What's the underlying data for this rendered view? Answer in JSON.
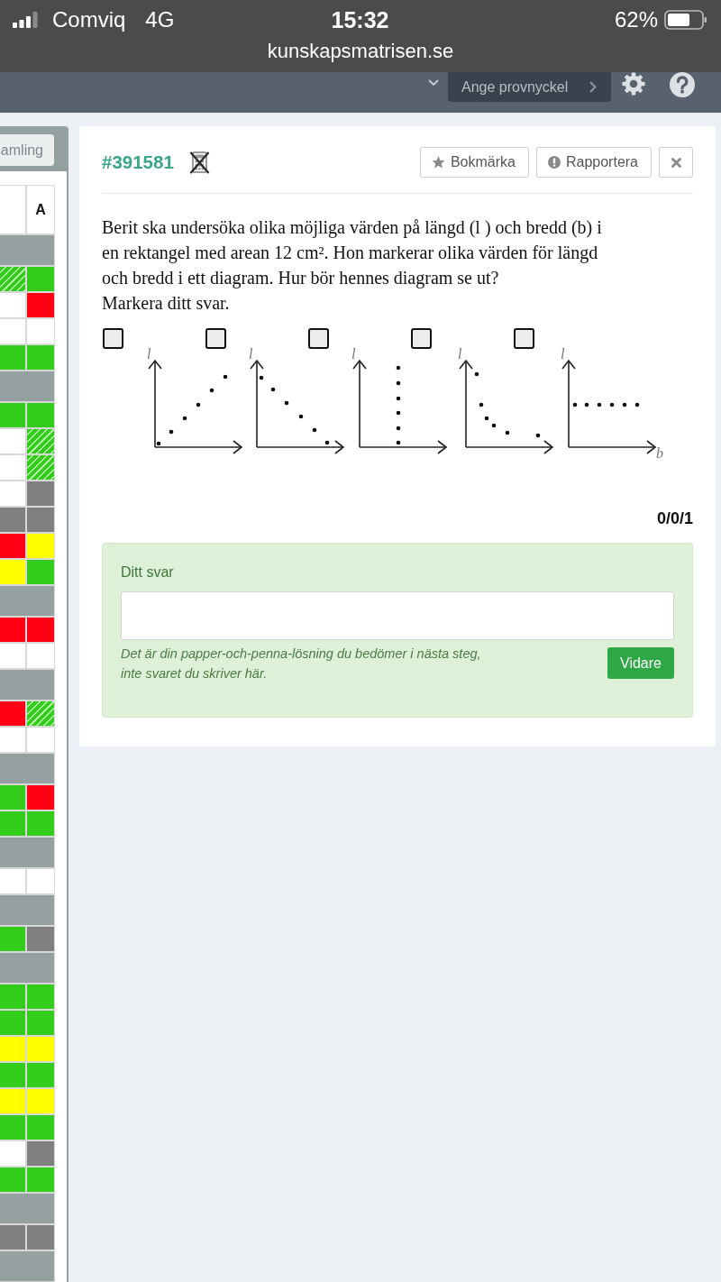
{
  "status_bar": {
    "carrier": "Comviq",
    "network": "4G",
    "time": "15:32",
    "battery": "62%"
  },
  "address_bar": {
    "url": "kunskapsmatrisen.se"
  },
  "nav_bar": {
    "key_button": "Ange provnyckel"
  },
  "side_panel": {
    "button": "amling",
    "header": {
      "column_2": "A"
    },
    "rows": [
      {
        "kind": "group"
      },
      {
        "kind": "cells",
        "cells": [
          {
            "color": "#33cc1c",
            "hatched": true
          },
          {
            "color": "#33cc1c",
            "hatched": false
          }
        ]
      },
      {
        "kind": "cells",
        "cells": [
          {
            "color": "#ffffff",
            "hatched": false
          },
          {
            "color": "#ff0015",
            "hatched": false
          }
        ]
      },
      {
        "kind": "cells",
        "cells": [
          {
            "color": "#ffffff",
            "hatched": false
          },
          {
            "color": "#ffffff",
            "hatched": false
          }
        ]
      },
      {
        "kind": "cells",
        "cells": [
          {
            "color": "#33cc1c",
            "hatched": false
          },
          {
            "color": "#33cc1c",
            "hatched": false
          }
        ]
      },
      {
        "kind": "group"
      },
      {
        "kind": "cells",
        "cells": [
          {
            "color": "#33cc1c",
            "hatched": false
          },
          {
            "color": "#33cc1c",
            "hatched": false
          }
        ]
      },
      {
        "kind": "cells",
        "cells": [
          {
            "color": "#ffffff",
            "hatched": false
          },
          {
            "color": "#33cc1c",
            "hatched": true
          }
        ]
      },
      {
        "kind": "cells",
        "cells": [
          {
            "color": "#ffffff",
            "hatched": false
          },
          {
            "color": "#33cc1c",
            "hatched": true
          }
        ]
      },
      {
        "kind": "cells",
        "cells": [
          {
            "color": "#ffffff",
            "hatched": false
          },
          {
            "color": "#808080",
            "hatched": false
          }
        ]
      },
      {
        "kind": "cells",
        "cells": [
          {
            "color": "#808080",
            "hatched": false
          },
          {
            "color": "#808080",
            "hatched": false
          }
        ]
      },
      {
        "kind": "cells",
        "cells": [
          {
            "color": "#ff0015",
            "hatched": false
          },
          {
            "color": "#ffff00",
            "hatched": false
          }
        ]
      },
      {
        "kind": "cells",
        "cells": [
          {
            "color": "#ffff00",
            "hatched": false
          },
          {
            "color": "#33cc1c",
            "hatched": false
          }
        ]
      },
      {
        "kind": "group"
      },
      {
        "kind": "cells",
        "cells": [
          {
            "color": "#ff0015",
            "hatched": false
          },
          {
            "color": "#ff0015",
            "hatched": false
          }
        ]
      },
      {
        "kind": "cells",
        "cells": [
          {
            "color": "#ffffff",
            "hatched": false
          },
          {
            "color": "#ffffff",
            "hatched": false
          }
        ]
      },
      {
        "kind": "group"
      },
      {
        "kind": "cells",
        "cells": [
          {
            "color": "#ff0015",
            "hatched": false
          },
          {
            "color": "#33cc1c",
            "hatched": true
          }
        ]
      },
      {
        "kind": "cells",
        "cells": [
          {
            "color": "#ffffff",
            "hatched": false
          },
          {
            "color": "#ffffff",
            "hatched": false
          }
        ]
      },
      {
        "kind": "group"
      },
      {
        "kind": "cells",
        "cells": [
          {
            "color": "#33cc1c",
            "hatched": false
          },
          {
            "color": "#ff0015",
            "hatched": false
          }
        ]
      },
      {
        "kind": "cells",
        "cells": [
          {
            "color": "#33cc1c",
            "hatched": false
          },
          {
            "color": "#33cc1c",
            "hatched": false
          }
        ]
      },
      {
        "kind": "group"
      },
      {
        "kind": "cells",
        "cells": [
          {
            "color": "#ffffff",
            "hatched": false
          },
          {
            "color": "#ffffff",
            "hatched": false
          }
        ]
      },
      {
        "kind": "group"
      },
      {
        "kind": "cells",
        "cells": [
          {
            "color": "#33cc1c",
            "hatched": false
          },
          {
            "color": "#808080",
            "hatched": false
          }
        ]
      },
      {
        "kind": "group"
      },
      {
        "kind": "cells",
        "cells": [
          {
            "color": "#33cc1c",
            "hatched": false
          },
          {
            "color": "#33cc1c",
            "hatched": false
          }
        ]
      },
      {
        "kind": "cells",
        "cells": [
          {
            "color": "#33cc1c",
            "hatched": false
          },
          {
            "color": "#33cc1c",
            "hatched": false
          }
        ]
      },
      {
        "kind": "cells",
        "cells": [
          {
            "color": "#ffff00",
            "hatched": false
          },
          {
            "color": "#ffff00",
            "hatched": false
          }
        ]
      },
      {
        "kind": "cells",
        "cells": [
          {
            "color": "#33cc1c",
            "hatched": false
          },
          {
            "color": "#33cc1c",
            "hatched": false
          }
        ]
      },
      {
        "kind": "cells",
        "cells": [
          {
            "color": "#ffff00",
            "hatched": false
          },
          {
            "color": "#ffff00",
            "hatched": false
          }
        ]
      },
      {
        "kind": "cells",
        "cells": [
          {
            "color": "#33cc1c",
            "hatched": false
          },
          {
            "color": "#33cc1c",
            "hatched": false
          }
        ]
      },
      {
        "kind": "cells",
        "cells": [
          {
            "color": "#ffffff",
            "hatched": false
          },
          {
            "color": "#808080",
            "hatched": false
          }
        ]
      },
      {
        "kind": "cells",
        "cells": [
          {
            "color": "#33cc1c",
            "hatched": false
          },
          {
            "color": "#33cc1c",
            "hatched": false
          }
        ]
      },
      {
        "kind": "group"
      },
      {
        "kind": "cells",
        "cells": [
          {
            "color": "#808080",
            "hatched": false
          },
          {
            "color": "#808080",
            "hatched": false
          }
        ]
      },
      {
        "kind": "group"
      }
    ]
  },
  "question_card": {
    "id": "#391581",
    "calculator_allowed": false,
    "buttons": [
      {
        "kind": "bookmark",
        "label": "Bokmärka"
      },
      {
        "kind": "report",
        "label": "Rapportera"
      },
      {
        "kind": "close"
      }
    ],
    "question": "Berit ska undersöka olika möjliga värden på längd (l ) och bredd (b) i en rektangel med arean 12 cm². Hon markerar olika värden för längd och bredd i ett diagram. Hur bör hennes diagram se ut?",
    "instruction": "Markera ditt svar.",
    "options": [
      {
        "checked": false,
        "kind": "rising",
        "y_axis_label": "l"
      },
      {
        "checked": false,
        "kind": "falling",
        "y_axis_label": "l"
      },
      {
        "checked": false,
        "kind": "vertical",
        "y_axis_label": "l"
      },
      {
        "checked": false,
        "kind": "curve",
        "y_axis_label": "l"
      },
      {
        "checked": false,
        "kind": "horizontal",
        "y_axis_label": "l",
        "x_axis_label": "b"
      }
    ],
    "score": "0/0/1",
    "answer": {
      "label": "Ditt svar",
      "hint": "Det är din papper-och-penna-lösning du bedömer i nästa steg, inte svaret du skriver här.",
      "submit": "Vidare"
    }
  }
}
